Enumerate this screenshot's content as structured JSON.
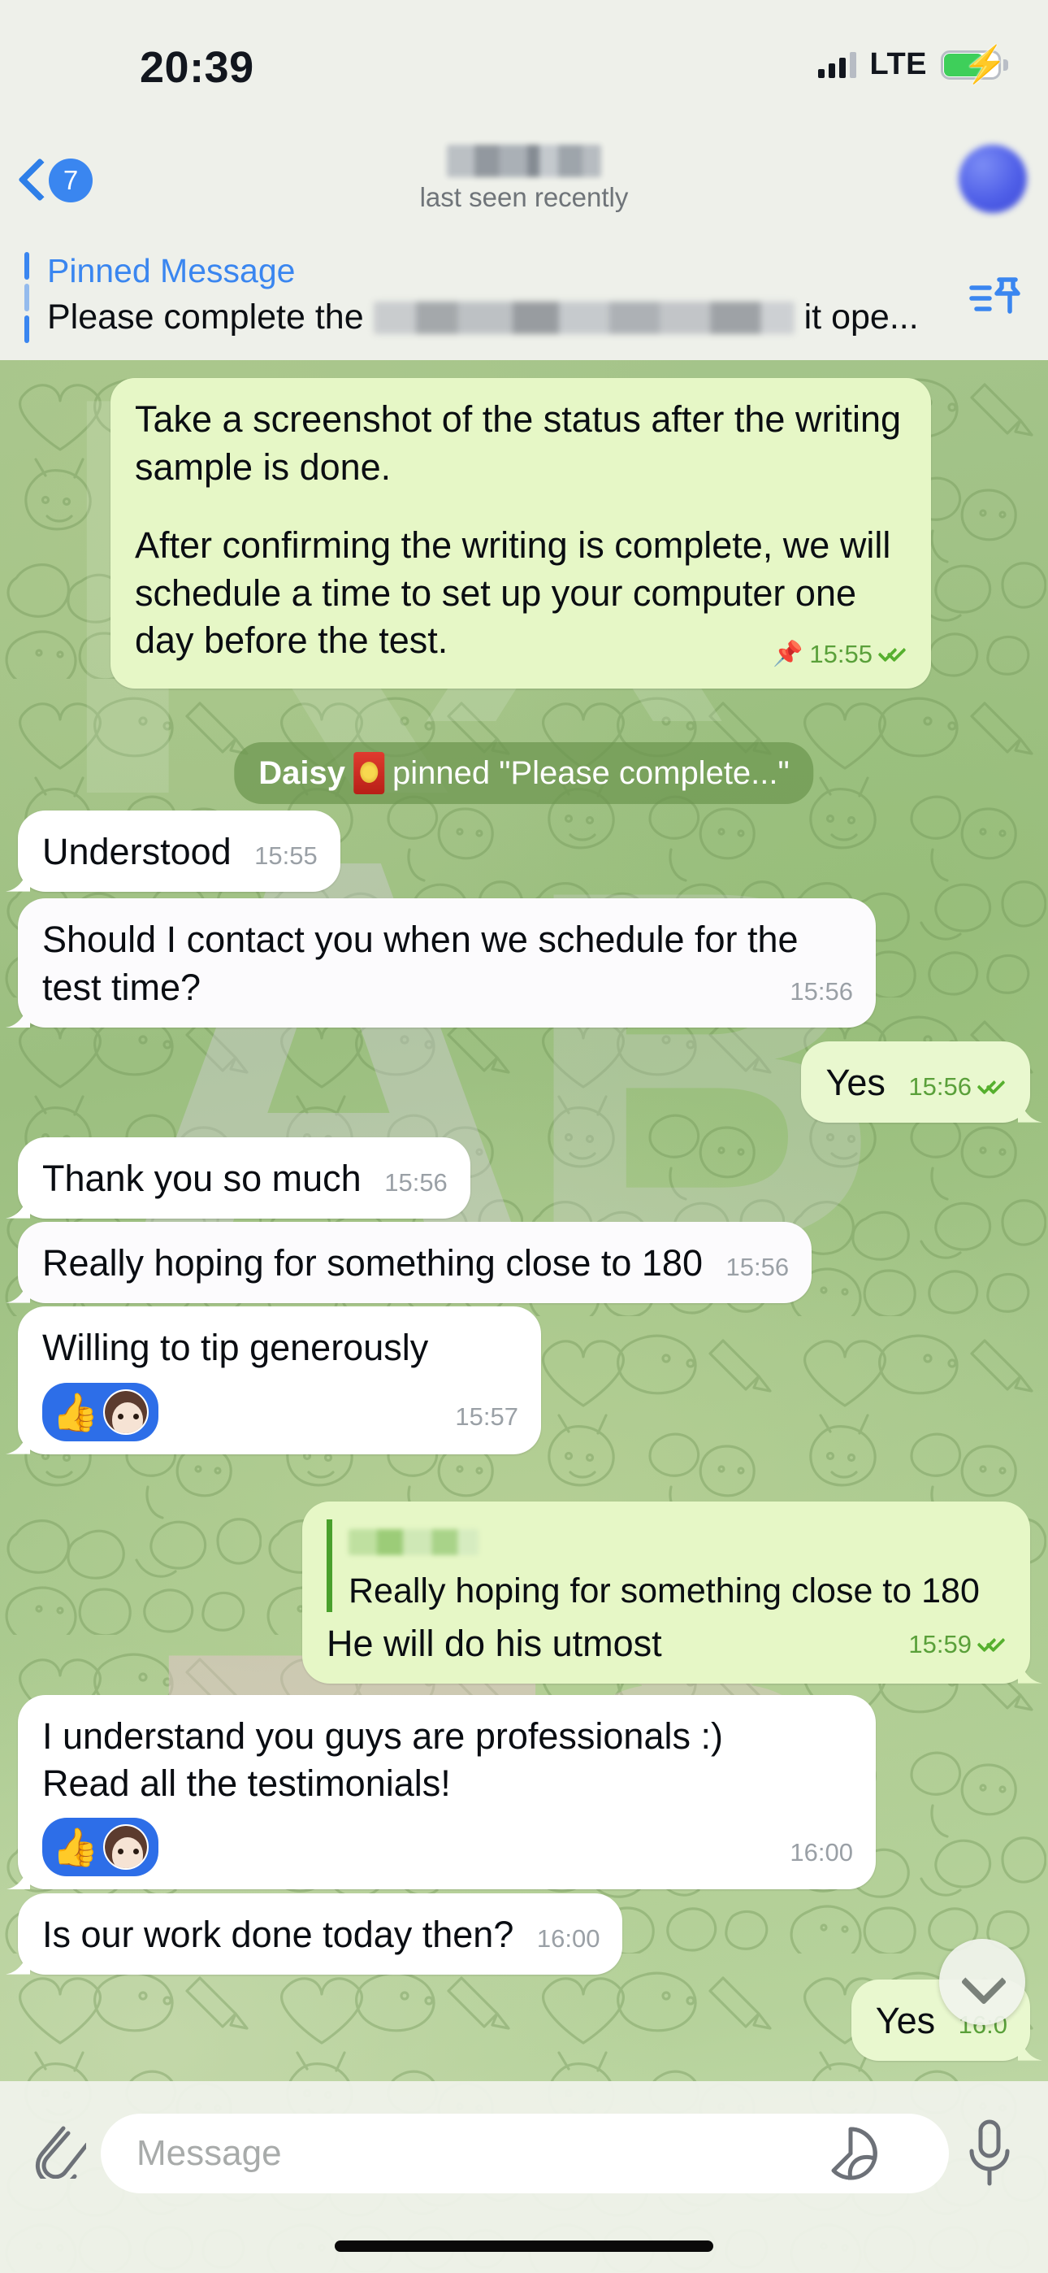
{
  "status_bar": {
    "time": "20:39",
    "network": "LTE",
    "signal_bars_filled": 3,
    "signal_bars_total": 4,
    "battery_charging": true,
    "battery_color": "#3ecf5a"
  },
  "header": {
    "back_badge": "7",
    "contact_name_redacted": true,
    "subtitle": "last seen recently",
    "avatar_redacted": true,
    "accent_color": "#3a86f0"
  },
  "pinned_bar": {
    "title": "Pinned Message",
    "text_before": "Please complete the",
    "text_after": "it ope...",
    "icon": "pinned-messages-icon",
    "accent_color": "#3a86f0"
  },
  "service_message": {
    "actor": "Daisy",
    "emoji": "red-envelope",
    "action": "pinned \"Please complete...\""
  },
  "messages": [
    {
      "id": "m1",
      "direction": "out",
      "paragraphs": [
        "Take a screenshot of the status after the writing sample is done.",
        "After confirming the writing is complete, we will schedule a time to set up your computer one day before the test."
      ],
      "time": "15:55",
      "pinned": true,
      "ticks": "double"
    },
    {
      "id": "m2",
      "direction": "in",
      "text": "Understood",
      "time": "15:55"
    },
    {
      "id": "m3",
      "direction": "in",
      "text": "Should I contact you when we schedule for the test time?",
      "time": "15:56"
    },
    {
      "id": "m4",
      "direction": "out",
      "text": "Yes",
      "time": "15:56",
      "ticks": "double"
    },
    {
      "id": "m5",
      "direction": "in",
      "text": "Thank you so much",
      "time": "15:56"
    },
    {
      "id": "m6",
      "direction": "in",
      "text": "Really hoping for something close to 180",
      "time": "15:56"
    },
    {
      "id": "m7",
      "direction": "in",
      "text": "Willing to tip generously",
      "time": "15:57",
      "reaction": {
        "emoji": "thumbs-up",
        "avatar": "girl-avatar"
      }
    },
    {
      "id": "m8",
      "direction": "out",
      "reply_quote": {
        "sender_redacted": true,
        "text": "Really hoping for something close to 180"
      },
      "text": "He will do his utmost",
      "time": "15:59",
      "ticks": "double"
    },
    {
      "id": "m9",
      "direction": "in",
      "lines": [
        "I understand you guys are professionals :)",
        "Read all the testimonials!"
      ],
      "time": "16:00",
      "reaction": {
        "emoji": "thumbs-up",
        "avatar": "girl-avatar"
      }
    },
    {
      "id": "m10",
      "direction": "in",
      "text": "Is our work done today then?",
      "time": "16:00"
    },
    {
      "id": "m11",
      "direction": "out",
      "text": "Yes",
      "time": "16:0",
      "ticks": "double"
    }
  ],
  "scroll_down_button": {
    "icon": "chevron-down-icon"
  },
  "input_bar": {
    "attach_icon": "paperclip-icon",
    "placeholder": "Message",
    "value": "",
    "sticker_icon": "sticker-icon",
    "mic_icon": "microphone-icon"
  }
}
